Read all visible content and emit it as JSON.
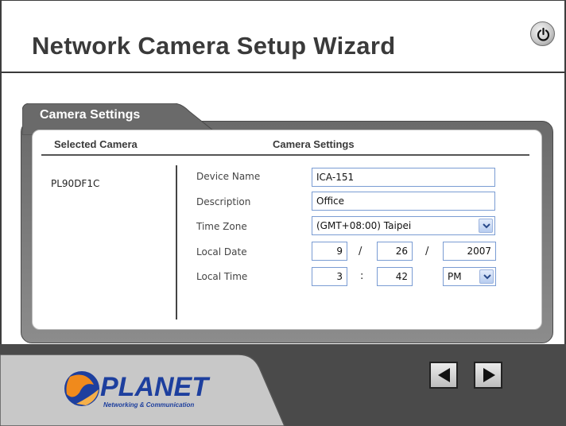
{
  "header": {
    "title": "Network Camera Setup Wizard",
    "power_icon": "power-icon"
  },
  "tab": {
    "label": "Camera Settings"
  },
  "table": {
    "col_selected": "Selected Camera",
    "col_settings": "Camera Settings",
    "selected_camera": "PL90DF1C"
  },
  "form": {
    "device_name_label": "Device Name",
    "device_name_value": "ICA-151",
    "description_label": "Description",
    "description_value": "Office",
    "time_zone_label": "Time Zone",
    "time_zone_value": "(GMT+08:00) Taipei",
    "local_date_label": "Local Date",
    "date_month": "9",
    "date_day": "26",
    "date_year": "2007",
    "date_sep": "/",
    "local_time_label": "Local Time",
    "time_hour": "3",
    "time_minute": "42",
    "time_sep": ":",
    "time_ampm": "PM"
  },
  "footer": {
    "brand": "PLANET",
    "tagline": "Networking & Communication",
    "prev_icon": "previous-arrow-icon",
    "next_icon": "next-arrow-icon"
  },
  "colors": {
    "panel_gray": "#7a7a7a",
    "input_border": "#7a9cd3",
    "brand_blue": "#1d3f9e",
    "brand_orange": "#f08a1c"
  }
}
